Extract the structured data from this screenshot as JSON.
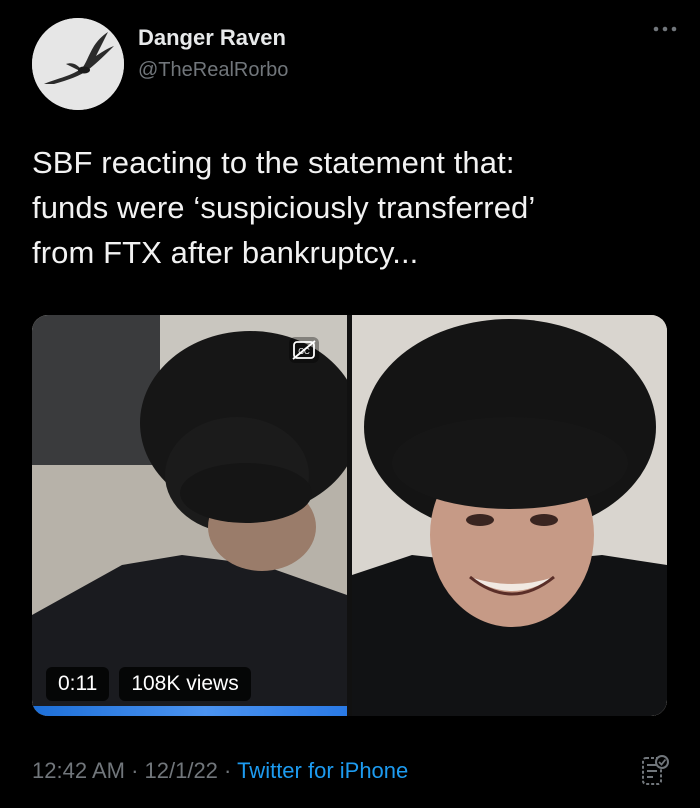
{
  "author": {
    "display_name": "Danger Raven",
    "handle": "@TheRealRorbo"
  },
  "tweet": {
    "text": "SBF reacting to the statement that:\nfunds were ‘suspiciously transferred’\nfrom FTX after bankruptcy..."
  },
  "media": {
    "duration": "0:11",
    "views": "108K views",
    "progress_fraction": 1.0
  },
  "meta": {
    "time": "12:42 AM",
    "separator1": " · ",
    "date": "12/1/22",
    "separator2": " · ",
    "source": "Twitter for iPhone"
  },
  "icons": {
    "more": "more-icon",
    "captions": "closed-captions-icon",
    "analytics": "analytics-icon"
  },
  "colors": {
    "background": "#000000",
    "text_primary": "#e7e9ea",
    "text_secondary": "#71767b",
    "link": "#1d9bf0",
    "video_progress": "#1d6fd8"
  }
}
